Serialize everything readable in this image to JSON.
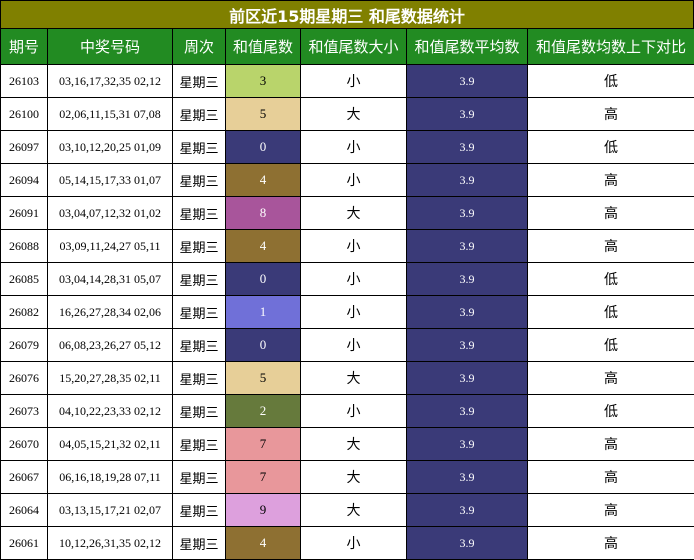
{
  "title": "前区近15期星期三 和尾数据统计",
  "headers": [
    "期号",
    "中奖号码",
    "周次",
    "和值尾数",
    "和值尾数大小",
    "和值尾数平均数",
    "和值尾数均数上下对比"
  ],
  "tail_colors": {
    "0": {
      "bg": "#3a3a78",
      "fg": "#ffffff"
    },
    "1": {
      "bg": "#7070d8",
      "fg": "#ffffff"
    },
    "2": {
      "bg": "#667a3c",
      "fg": "#ffffff"
    },
    "3": {
      "bg": "#b9d46b",
      "fg": "#000000"
    },
    "4": {
      "bg": "#8e7032",
      "fg": "#ffffff"
    },
    "5": {
      "bg": "#e7cf98",
      "fg": "#000000"
    },
    "7": {
      "bg": "#e8979b",
      "fg": "#000000"
    },
    "8": {
      "bg": "#a8559b",
      "fg": "#ffffff"
    },
    "9": {
      "bg": "#dda0dd",
      "fg": "#000000"
    }
  },
  "rows": [
    {
      "period": "26103",
      "numbers": "03,16,17,32,35 02,12",
      "weekday": "星期三",
      "tail": "3",
      "size": "小",
      "avg": "3.9",
      "cmp": "低"
    },
    {
      "period": "26100",
      "numbers": "02,06,11,15,31 07,08",
      "weekday": "星期三",
      "tail": "5",
      "size": "大",
      "avg": "3.9",
      "cmp": "高"
    },
    {
      "period": "26097",
      "numbers": "03,10,12,20,25 01,09",
      "weekday": "星期三",
      "tail": "0",
      "size": "小",
      "avg": "3.9",
      "cmp": "低"
    },
    {
      "period": "26094",
      "numbers": "05,14,15,17,33 01,07",
      "weekday": "星期三",
      "tail": "4",
      "size": "小",
      "avg": "3.9",
      "cmp": "高"
    },
    {
      "period": "26091",
      "numbers": "03,04,07,12,32 01,02",
      "weekday": "星期三",
      "tail": "8",
      "size": "大",
      "avg": "3.9",
      "cmp": "高"
    },
    {
      "period": "26088",
      "numbers": "03,09,11,24,27 05,11",
      "weekday": "星期三",
      "tail": "4",
      "size": "小",
      "avg": "3.9",
      "cmp": "高"
    },
    {
      "period": "26085",
      "numbers": "03,04,14,28,31 05,07",
      "weekday": "星期三",
      "tail": "0",
      "size": "小",
      "avg": "3.9",
      "cmp": "低"
    },
    {
      "period": "26082",
      "numbers": "16,26,27,28,34 02,06",
      "weekday": "星期三",
      "tail": "1",
      "size": "小",
      "avg": "3.9",
      "cmp": "低"
    },
    {
      "period": "26079",
      "numbers": "06,08,23,26,27 05,12",
      "weekday": "星期三",
      "tail": "0",
      "size": "小",
      "avg": "3.9",
      "cmp": "低"
    },
    {
      "period": "26076",
      "numbers": "15,20,27,28,35 02,11",
      "weekday": "星期三",
      "tail": "5",
      "size": "大",
      "avg": "3.9",
      "cmp": "高"
    },
    {
      "period": "26073",
      "numbers": "04,10,22,23,33 02,12",
      "weekday": "星期三",
      "tail": "2",
      "size": "小",
      "avg": "3.9",
      "cmp": "低"
    },
    {
      "period": "26070",
      "numbers": "04,05,15,21,32 02,11",
      "weekday": "星期三",
      "tail": "7",
      "size": "大",
      "avg": "3.9",
      "cmp": "高"
    },
    {
      "period": "26067",
      "numbers": "06,16,18,19,28 07,11",
      "weekday": "星期三",
      "tail": "7",
      "size": "大",
      "avg": "3.9",
      "cmp": "高"
    },
    {
      "period": "26064",
      "numbers": "03,13,15,17,21 02,07",
      "weekday": "星期三",
      "tail": "9",
      "size": "大",
      "avg": "3.9",
      "cmp": "高"
    },
    {
      "period": "26061",
      "numbers": "10,12,26,31,35 02,12",
      "weekday": "星期三",
      "tail": "4",
      "size": "小",
      "avg": "3.9",
      "cmp": "高"
    }
  ]
}
